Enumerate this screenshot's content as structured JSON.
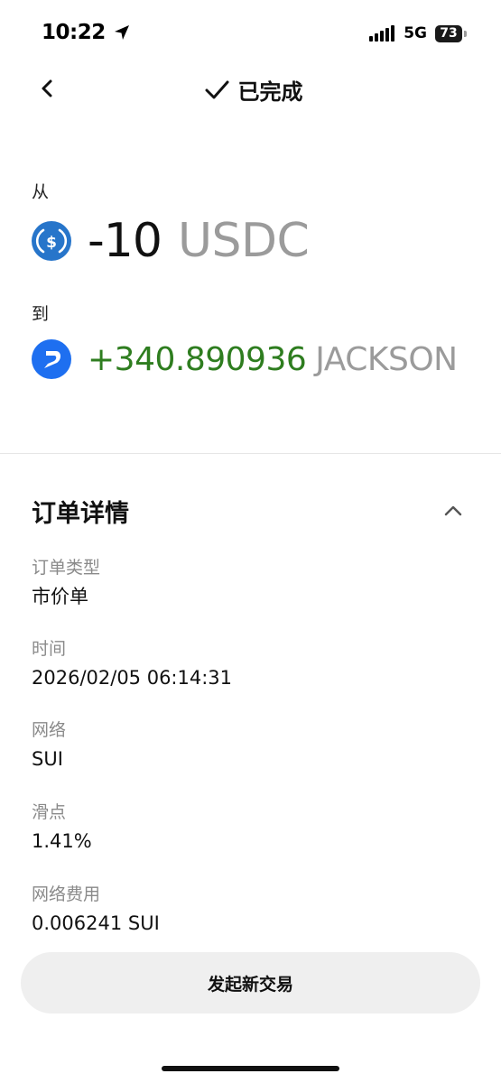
{
  "status_bar": {
    "time": "10:22",
    "network": "5G",
    "battery": "73"
  },
  "header": {
    "title": "已完成"
  },
  "swap": {
    "from_label": "从",
    "from_amount": "-10",
    "from_symbol": "USDC",
    "to_label": "到",
    "to_amount": "+340.890936",
    "to_symbol": "JACKSON"
  },
  "colors": {
    "positive": "#2e7d1f",
    "usdc_brand": "#2775ca",
    "jackson_brand": "#1e6ff0",
    "muted": "#9b9b9b"
  },
  "order_details": {
    "title": "订单详情",
    "items": [
      {
        "label": "订单类型",
        "value": "市价单"
      },
      {
        "label": "时间",
        "value": "2026/02/05 06:14:31"
      },
      {
        "label": "网络",
        "value": "SUI"
      },
      {
        "label": "滑点",
        "value": "1.41%"
      },
      {
        "label": "网络费用",
        "value": "0.006241 SUI"
      }
    ]
  },
  "actions": {
    "new_trade_label": "发起新交易"
  }
}
